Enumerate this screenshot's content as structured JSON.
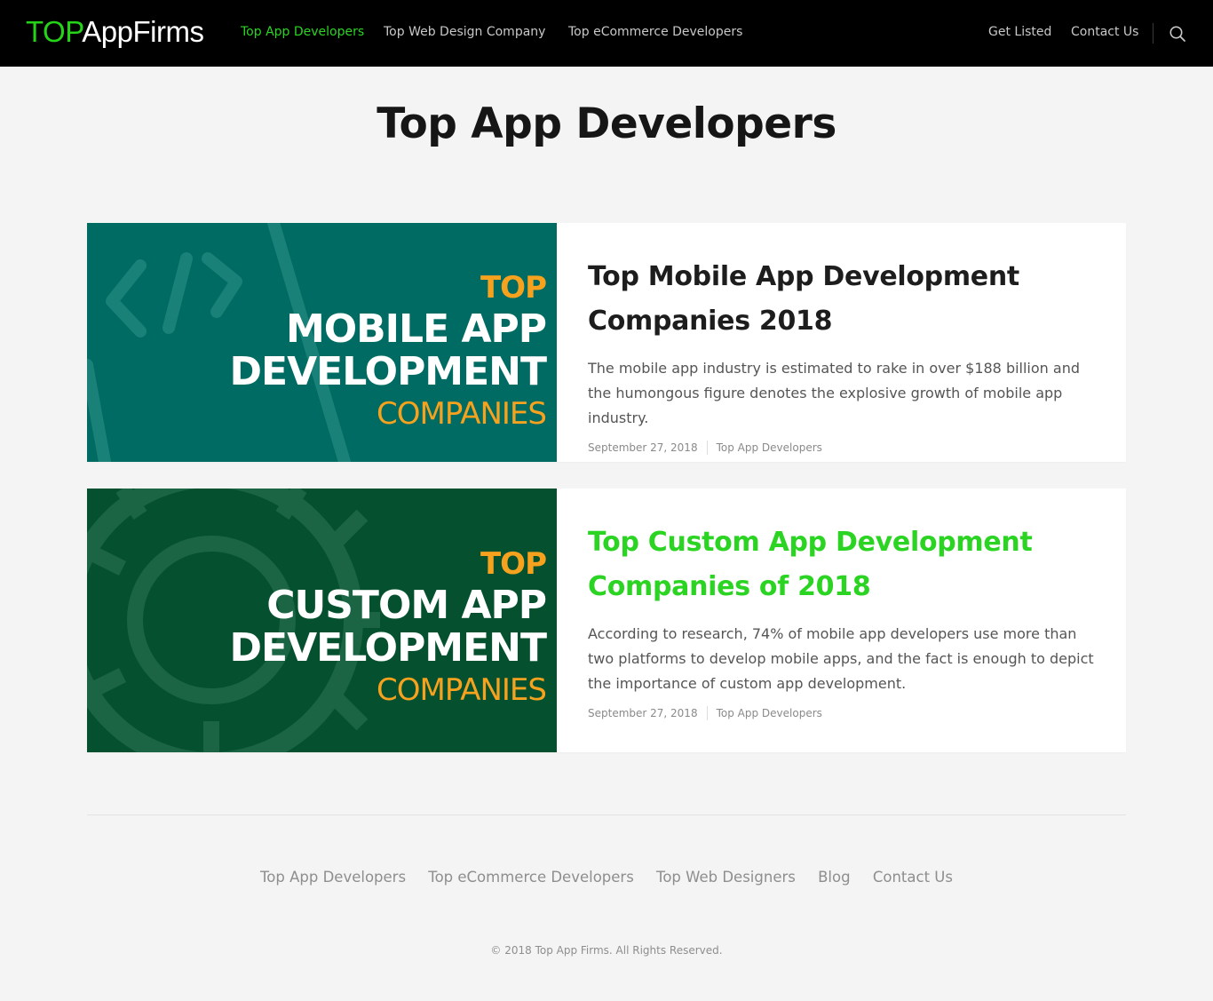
{
  "header": {
    "logo_top": "TOP",
    "logo_rest": "AppFirms",
    "nav": [
      {
        "label": "Top App Developers"
      },
      {
        "label": "Top Web Design Company"
      },
      {
        "label": "Top eCommerce Developers"
      }
    ],
    "right_nav": [
      {
        "label": "Get Listed"
      },
      {
        "label": "Contact Us"
      }
    ],
    "search_icon": "search-icon"
  },
  "page": {
    "title": "Top App Developers"
  },
  "posts": [
    {
      "image": {
        "line1": "TOP",
        "line2": "MOBILE APP",
        "line3": "DEVELOPMENT",
        "line4": "COMPANIES",
        "bg_color": "#006b62",
        "icon": "code-icon"
      },
      "title": "Top Mobile App Development Companies 2018",
      "excerpt": "The mobile app industry is estimated to rake in over $188 billion and the humongous figure denotes the explosive growth of mobile app industry.",
      "date": "September 27, 2018",
      "category": "Top App Developers"
    },
    {
      "image": {
        "line1": "TOP",
        "line2": "CUSTOM APP",
        "line3": "DEVELOPMENT",
        "line4": "COMPANIES",
        "bg_color": "#05512f",
        "icon": "gear-icon"
      },
      "title": "Top Custom App Development Companies of 2018",
      "excerpt": "According to research, 74% of mobile app developers use more than two platforms to develop mobile apps, and the fact is enough to depict the importance of custom app development.",
      "date": "September 27, 2018",
      "category": "Top App Developers"
    }
  ],
  "footer": {
    "links": [
      {
        "label": "Top App Developers"
      },
      {
        "label": "Top eCommerce Developers"
      },
      {
        "label": "Top Web Designers"
      },
      {
        "label": "Blog"
      },
      {
        "label": "Contact Us"
      }
    ],
    "copyright": "© 2018 Top App Firms. All Rights Reserved."
  },
  "colors": {
    "accent": "#2bd422",
    "header_bg": "#000000",
    "image_orange": "#f6a21e"
  }
}
